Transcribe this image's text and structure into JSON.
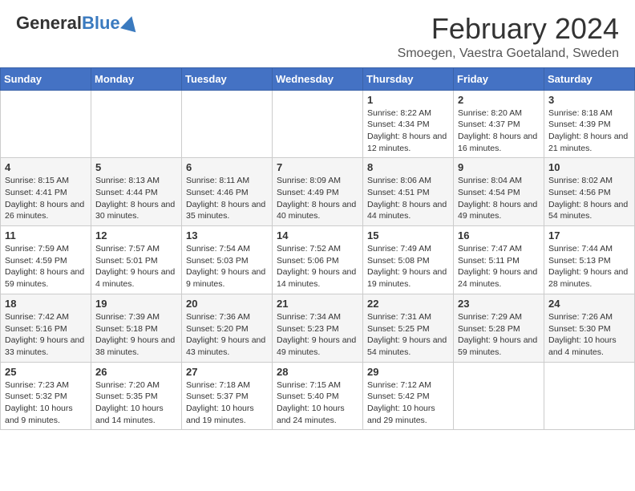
{
  "header": {
    "logo": {
      "general": "General",
      "blue": "Blue"
    },
    "title": "February 2024",
    "subtitle": "Smoegen, Vaestra Goetaland, Sweden"
  },
  "calendar": {
    "days_of_week": [
      "Sunday",
      "Monday",
      "Tuesday",
      "Wednesday",
      "Thursday",
      "Friday",
      "Saturday"
    ],
    "weeks": [
      [
        {
          "day": "",
          "info": ""
        },
        {
          "day": "",
          "info": ""
        },
        {
          "day": "",
          "info": ""
        },
        {
          "day": "",
          "info": ""
        },
        {
          "day": "1",
          "info": "Sunrise: 8:22 AM\nSunset: 4:34 PM\nDaylight: 8 hours and 12 minutes."
        },
        {
          "day": "2",
          "info": "Sunrise: 8:20 AM\nSunset: 4:37 PM\nDaylight: 8 hours and 16 minutes."
        },
        {
          "day": "3",
          "info": "Sunrise: 8:18 AM\nSunset: 4:39 PM\nDaylight: 8 hours and 21 minutes."
        }
      ],
      [
        {
          "day": "4",
          "info": "Sunrise: 8:15 AM\nSunset: 4:41 PM\nDaylight: 8 hours and 26 minutes."
        },
        {
          "day": "5",
          "info": "Sunrise: 8:13 AM\nSunset: 4:44 PM\nDaylight: 8 hours and 30 minutes."
        },
        {
          "day": "6",
          "info": "Sunrise: 8:11 AM\nSunset: 4:46 PM\nDaylight: 8 hours and 35 minutes."
        },
        {
          "day": "7",
          "info": "Sunrise: 8:09 AM\nSunset: 4:49 PM\nDaylight: 8 hours and 40 minutes."
        },
        {
          "day": "8",
          "info": "Sunrise: 8:06 AM\nSunset: 4:51 PM\nDaylight: 8 hours and 44 minutes."
        },
        {
          "day": "9",
          "info": "Sunrise: 8:04 AM\nSunset: 4:54 PM\nDaylight: 8 hours and 49 minutes."
        },
        {
          "day": "10",
          "info": "Sunrise: 8:02 AM\nSunset: 4:56 PM\nDaylight: 8 hours and 54 minutes."
        }
      ],
      [
        {
          "day": "11",
          "info": "Sunrise: 7:59 AM\nSunset: 4:59 PM\nDaylight: 8 hours and 59 minutes."
        },
        {
          "day": "12",
          "info": "Sunrise: 7:57 AM\nSunset: 5:01 PM\nDaylight: 9 hours and 4 minutes."
        },
        {
          "day": "13",
          "info": "Sunrise: 7:54 AM\nSunset: 5:03 PM\nDaylight: 9 hours and 9 minutes."
        },
        {
          "day": "14",
          "info": "Sunrise: 7:52 AM\nSunset: 5:06 PM\nDaylight: 9 hours and 14 minutes."
        },
        {
          "day": "15",
          "info": "Sunrise: 7:49 AM\nSunset: 5:08 PM\nDaylight: 9 hours and 19 minutes."
        },
        {
          "day": "16",
          "info": "Sunrise: 7:47 AM\nSunset: 5:11 PM\nDaylight: 9 hours and 24 minutes."
        },
        {
          "day": "17",
          "info": "Sunrise: 7:44 AM\nSunset: 5:13 PM\nDaylight: 9 hours and 28 minutes."
        }
      ],
      [
        {
          "day": "18",
          "info": "Sunrise: 7:42 AM\nSunset: 5:16 PM\nDaylight: 9 hours and 33 minutes."
        },
        {
          "day": "19",
          "info": "Sunrise: 7:39 AM\nSunset: 5:18 PM\nDaylight: 9 hours and 38 minutes."
        },
        {
          "day": "20",
          "info": "Sunrise: 7:36 AM\nSunset: 5:20 PM\nDaylight: 9 hours and 43 minutes."
        },
        {
          "day": "21",
          "info": "Sunrise: 7:34 AM\nSunset: 5:23 PM\nDaylight: 9 hours and 49 minutes."
        },
        {
          "day": "22",
          "info": "Sunrise: 7:31 AM\nSunset: 5:25 PM\nDaylight: 9 hours and 54 minutes."
        },
        {
          "day": "23",
          "info": "Sunrise: 7:29 AM\nSunset: 5:28 PM\nDaylight: 9 hours and 59 minutes."
        },
        {
          "day": "24",
          "info": "Sunrise: 7:26 AM\nSunset: 5:30 PM\nDaylight: 10 hours and 4 minutes."
        }
      ],
      [
        {
          "day": "25",
          "info": "Sunrise: 7:23 AM\nSunset: 5:32 PM\nDaylight: 10 hours and 9 minutes."
        },
        {
          "day": "26",
          "info": "Sunrise: 7:20 AM\nSunset: 5:35 PM\nDaylight: 10 hours and 14 minutes."
        },
        {
          "day": "27",
          "info": "Sunrise: 7:18 AM\nSunset: 5:37 PM\nDaylight: 10 hours and 19 minutes."
        },
        {
          "day": "28",
          "info": "Sunrise: 7:15 AM\nSunset: 5:40 PM\nDaylight: 10 hours and 24 minutes."
        },
        {
          "day": "29",
          "info": "Sunrise: 7:12 AM\nSunset: 5:42 PM\nDaylight: 10 hours and 29 minutes."
        },
        {
          "day": "",
          "info": ""
        },
        {
          "day": "",
          "info": ""
        }
      ]
    ]
  }
}
